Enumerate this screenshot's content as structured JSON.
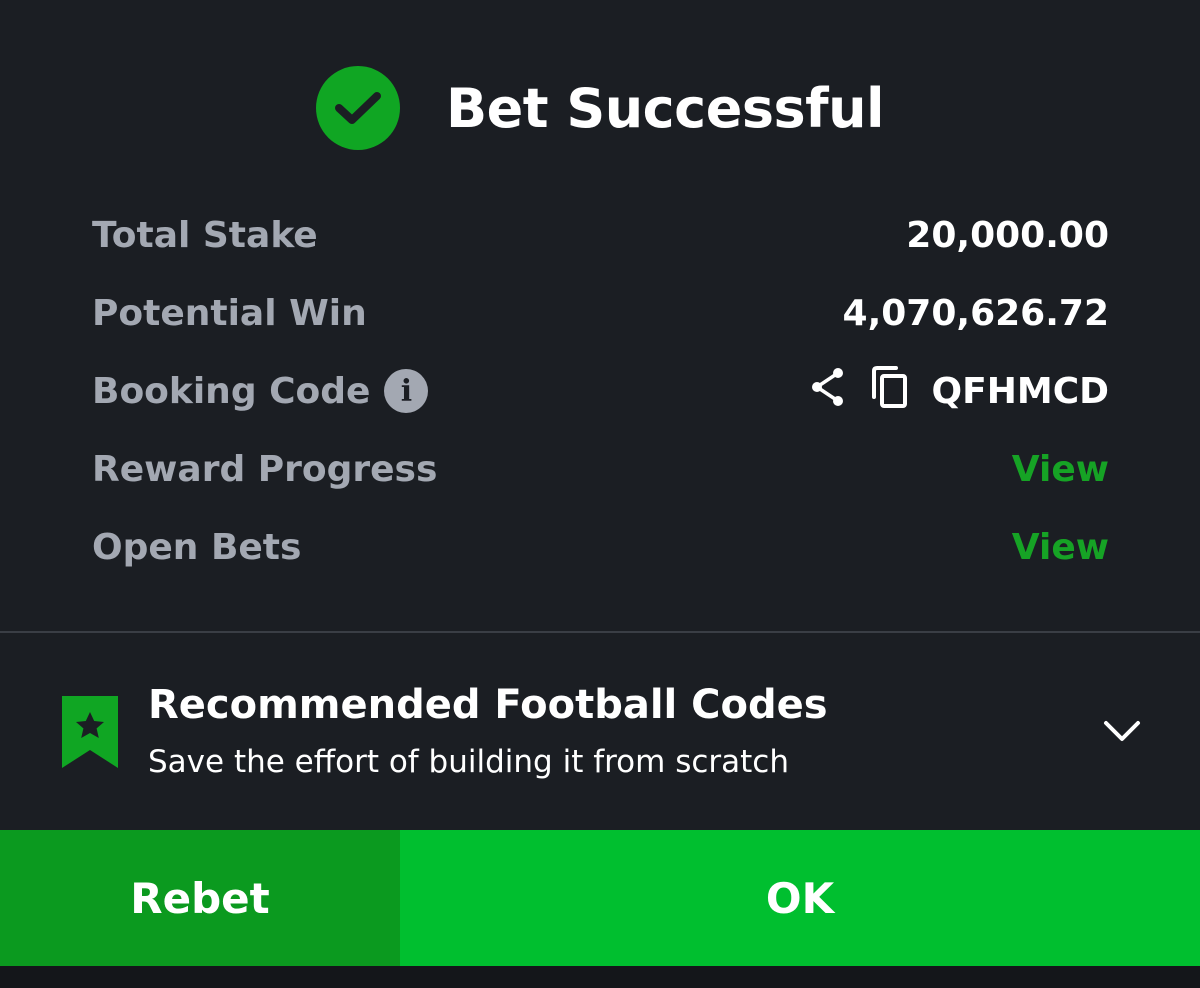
{
  "header": {
    "title": "Bet Successful",
    "icon": "check-circle-icon"
  },
  "summary": {
    "total_stake": {
      "label": "Total Stake",
      "value": "20,000.00"
    },
    "potential_win": {
      "label": "Potential Win",
      "value": "4,070,626.72"
    },
    "booking_code": {
      "label": "Booking Code",
      "value": "QFHMCD",
      "info_glyph": "i"
    },
    "reward_progress": {
      "label": "Reward Progress",
      "link": "View"
    },
    "open_bets": {
      "label": "Open Bets",
      "link": "View"
    }
  },
  "recommended": {
    "title": "Recommended Football Codes",
    "subtitle": "Save the effort of building it from scratch"
  },
  "buttons": {
    "rebet": "Rebet",
    "ok": "OK"
  },
  "colors": {
    "background": "#1b1e23",
    "accent_green": "#00bf2f",
    "rebet_green": "#0b9a1f",
    "link_green": "#16a325",
    "label_gray": "#a3a8b2"
  }
}
